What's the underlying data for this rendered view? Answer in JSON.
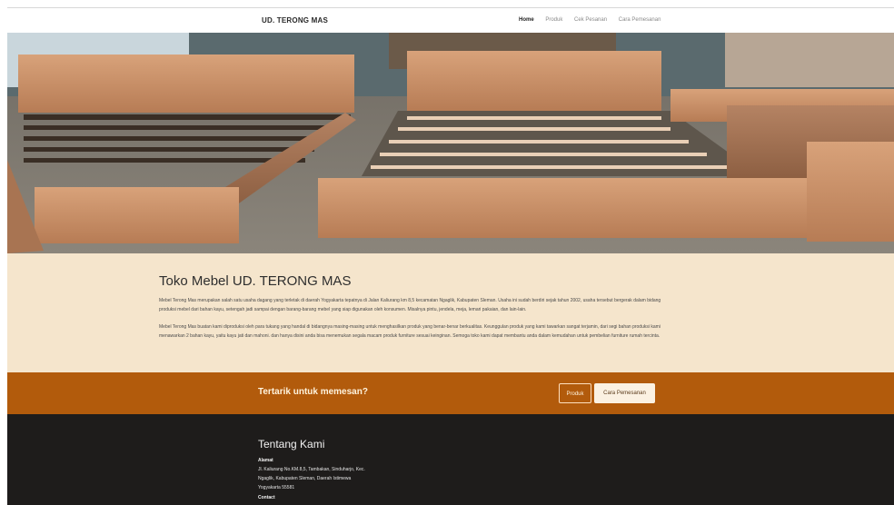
{
  "navbar": {
    "brand": "UD. TERONG MAS",
    "links": [
      "Home",
      "Produk",
      "Cek Pesanan",
      "Cara Pemesanan"
    ],
    "active_link": "Home"
  },
  "hero": {
    "image_description": "wooden bed frames photo"
  },
  "about": {
    "title": "Toko Mebel UD. TERONG MAS",
    "paragraph1_line1": "Mebel Terong Mas merupakan salah satu usaha dagang yang terletak di daerah Yogyakarta tepatnya di Jalan Kaliurang km 8,5 kecamatan Ngaglik, Kabupaten Sleman. Usaha ini sudah berdiri sejak tahun 2002, usaha tersebut bergerak dalam bidang",
    "paragraph1_line2": "produksi mebel dari bahan kayu, setengah jadi sampai dengan barang-barang mebel yang siap digunakan oleh konsumen. Misalnya pintu, jendela, meja, lemari pakaian, dan lain-lain.",
    "paragraph2_line1": "Mebel Terong Mas buatan kami diproduksi oleh para tukang yang handal di bidangnya masing-masing untuk menghasilkan produk yang benar-benar berkualitas. Keunggulan produk yang kami tawarkan sangat terjamin, dari segi bahan produksi kami",
    "paragraph2_line2": "menawarkan 2 bahan kayu, yaitu kayu jati dan mahoni. dan hanya disini anda bisa menemukan segala macam produk furniture sesuai keinginan. Semoga toko kami dapat membantu anda dalam kemudahan untuk pembelian furniture rumah tercinta."
  },
  "cta": {
    "text": "Tertarik untuk memesan?",
    "button1": "Produk",
    "button2": "Cara Pemesanan"
  },
  "footer": {
    "title": "Tentang Kami",
    "address_label": "Alamat",
    "address_line1": "Jl. Kaliurang No.KM.8,5, Tambakan, Sinduharjo, Kec.",
    "address_line2": "Ngaglik, Kabupaten Sleman, Daerah Istimewa",
    "address_line3": "Yogyakarta 55581",
    "contact_label": "Contact"
  },
  "colors": {
    "about_bg": "#f5e5cc",
    "cta_bg": "#b25b0c",
    "footer_bg": "#1e1c1b"
  }
}
